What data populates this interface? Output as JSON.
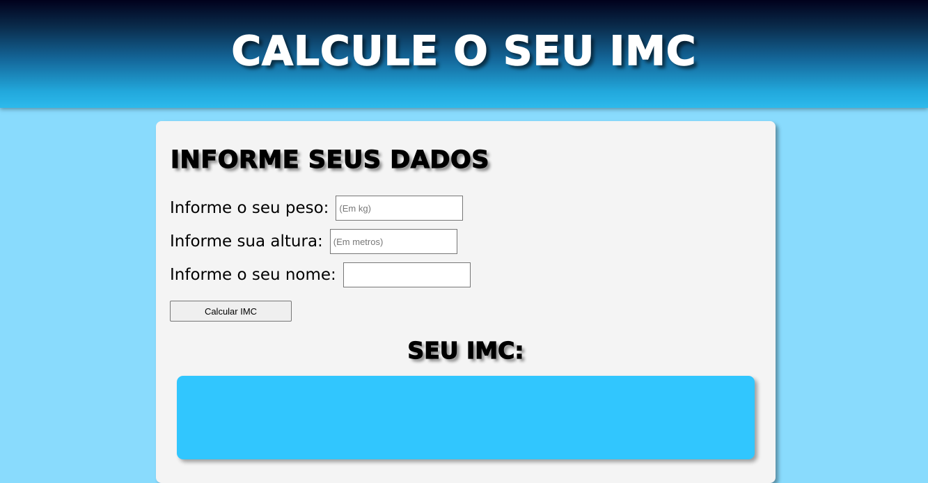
{
  "header": {
    "title": "CALCULE O SEU IMC"
  },
  "form": {
    "heading": "INFORME SEUS DADOS",
    "fields": [
      {
        "label": "Informe o seu peso:",
        "placeholder": "(Em kg)",
        "value": ""
      },
      {
        "label": "Informe sua altura:",
        "placeholder": "(Em metros)",
        "value": ""
      },
      {
        "label": "Informe o seu nome:",
        "placeholder": "",
        "value": ""
      }
    ],
    "submit_label": "Calcular IMC"
  },
  "result": {
    "heading": "SEU IMC:",
    "text": ""
  },
  "colors": {
    "page_background": "#89dbfd",
    "card_background": "#f4f4f4",
    "result_box": "#31c6fe",
    "header_top": "#01011c",
    "header_bottom": "#2dbaec"
  }
}
